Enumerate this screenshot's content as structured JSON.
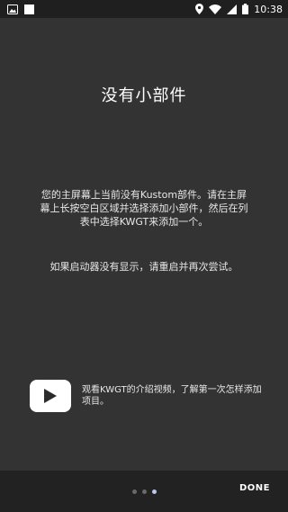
{
  "status_bar": {
    "time": "10:38",
    "left_icons": [
      "image-notification-icon",
      "square-notification-icon"
    ],
    "right_icons": [
      "location-icon",
      "wifi-icon",
      "signal-icon",
      "battery-icon"
    ]
  },
  "intro": {
    "title": "没有小部件",
    "paragraph1": "您的主屏幕上当前没有Kustom部件。请在主屏幕上长按空白区域并选择添加小部件，然后在列表中选择KWGT来添加一个。",
    "paragraph2": "如果启动器没有显示，请重启并再次尝试。",
    "video_text": "观看KWGT的介绍视频，了解第一次怎样添加项目。",
    "video_icon": "play-icon"
  },
  "pager": {
    "count": 3,
    "active_index": 2
  },
  "footer": {
    "done_label": "DONE"
  },
  "colors": {
    "background": "#333333",
    "status_bar": "#1f1f1f",
    "bottom_bar": "#222222",
    "active_dot": "#b9c9ea"
  }
}
